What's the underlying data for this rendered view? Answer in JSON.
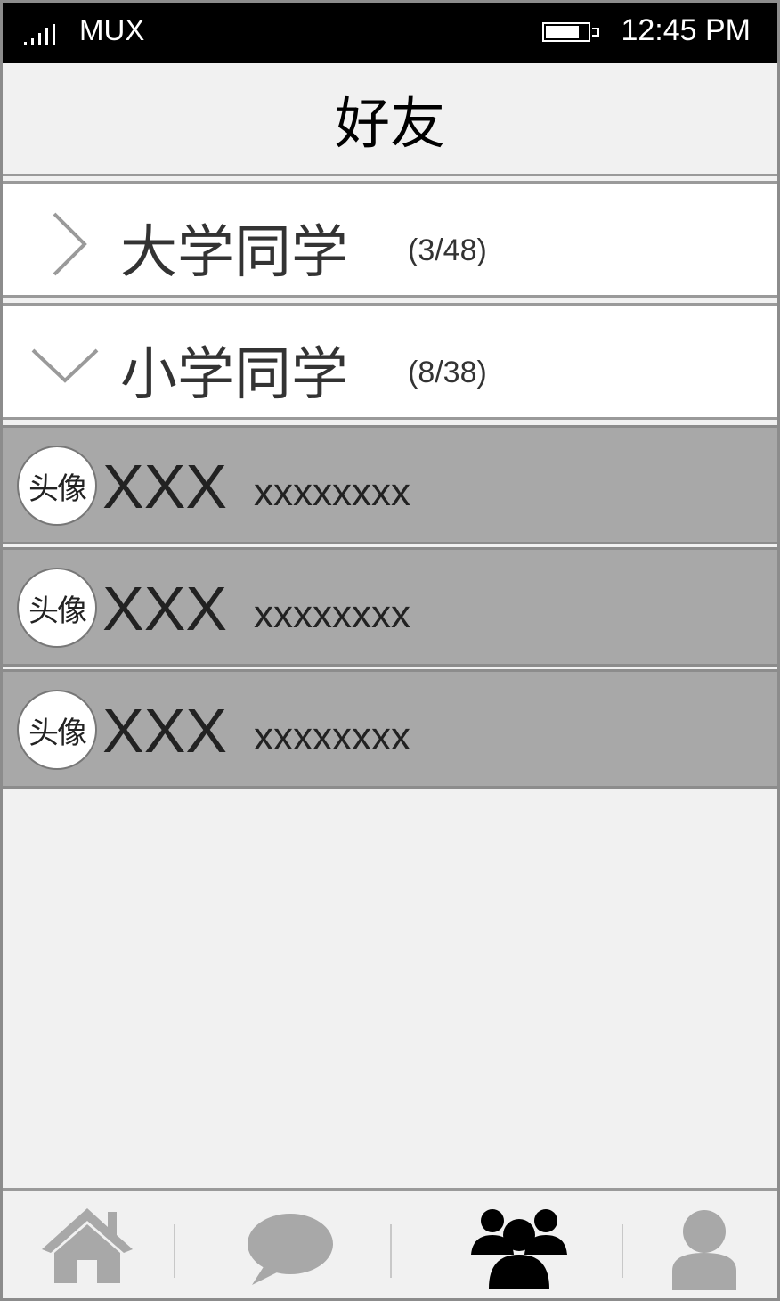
{
  "status_bar": {
    "carrier": "MUX",
    "time": "12:45 PM",
    "signal_icon": "signal-icon",
    "battery_icon": "battery-icon"
  },
  "header": {
    "title": "好友"
  },
  "groups": [
    {
      "name": "大学同学",
      "count": "(3/48)",
      "state": "collapsed",
      "icon": "chevron-right-icon"
    },
    {
      "name": "小学同学",
      "count": "(8/38)",
      "state": "expanded",
      "icon": "chevron-down-icon"
    }
  ],
  "friends": [
    {
      "avatar_label": "头像",
      "name": "XXX",
      "signature": "xxxxxxxx"
    },
    {
      "avatar_label": "头像",
      "name": "XXX",
      "signature": "xxxxxxxx"
    },
    {
      "avatar_label": "头像",
      "name": "XXX",
      "signature": "xxxxxxxx"
    }
  ],
  "tabbar": {
    "items": [
      {
        "icon": "home-icon",
        "active": false
      },
      {
        "icon": "chat-bubble-icon",
        "active": false
      },
      {
        "icon": "friends-group-icon",
        "active": true
      },
      {
        "icon": "user-profile-icon",
        "active": false
      }
    ],
    "active_color": "#000000",
    "inactive_color": "#a8a8a8"
  }
}
